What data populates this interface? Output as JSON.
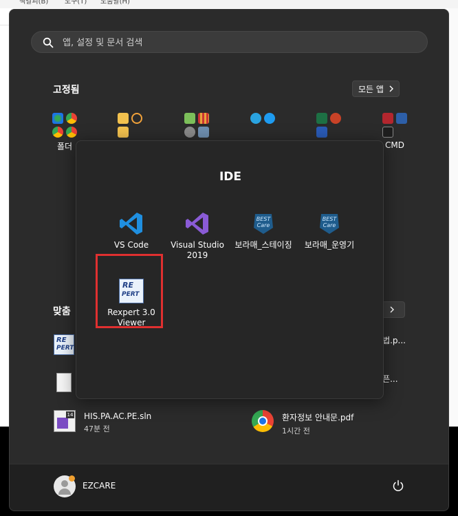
{
  "menubar": [
    "책갈피(B)",
    "도구(T)",
    "도움말(H)"
  ],
  "search": {
    "placeholder": "앱, 설정 및 문서 검색"
  },
  "pinned": {
    "title": "고정됨",
    "all_apps": "모든 앱",
    "labels": [
      "폴더",
      "",
      "",
      "",
      "",
      "CMD"
    ]
  },
  "recommended": {
    "title": "맞춤",
    "items": [
      {
        "name": "HIS.PA.AC.PE.sln",
        "time": "47분 전"
      },
      {
        "name": "환자정보 안내문.pdf",
        "time": "1시간 전"
      }
    ],
    "partial": [
      "르는법.p...",
      "바이픈..."
    ]
  },
  "folder": {
    "title": "IDE",
    "apps": [
      {
        "name": "VS Code"
      },
      {
        "name": "Visual Studio 2019"
      },
      {
        "name": "보라매_스테이징"
      },
      {
        "name": "보라매_운영기"
      },
      {
        "name": "Rexpert 3.0 Viewer"
      }
    ]
  },
  "user": {
    "name": "EZCARE"
  },
  "colors": {
    "accent_highlight": "#e03030",
    "menu_bg": "#2b2b2b"
  }
}
